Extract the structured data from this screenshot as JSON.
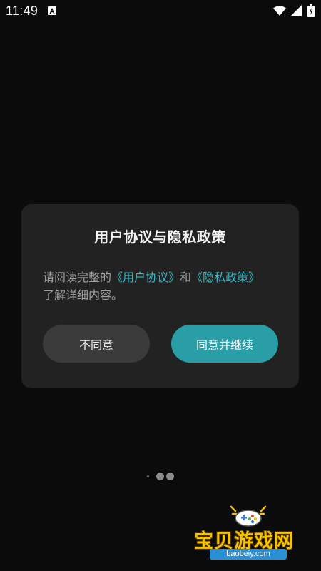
{
  "status_bar": {
    "time": "11:49",
    "app_icon": "a-notification-icon",
    "wifi_icon": "wifi-icon",
    "signal_icon": "signal-icon",
    "battery_icon": "battery-icon"
  },
  "dialog": {
    "title": "用户协议与隐私政策",
    "message_prefix": "请阅读完整的",
    "link_user_agreement": "《用户协议》",
    "message_and": "和",
    "link_privacy_policy": "《隐私政策》",
    "message_suffix": "了解详细内容。",
    "disagree_label": "不同意",
    "agree_label": "同意并继续"
  },
  "colors": {
    "background": "#0b0b0b",
    "dialog_background": "#222222",
    "link": "#39b7c4",
    "agree_button": "#2a9ea7",
    "disagree_button": "#3b3b3b"
  },
  "pager": {
    "pages": 2
  },
  "watermark": {
    "text": "宝贝游戏网",
    "url": "baobeiy.com",
    "logo_icon": "gamepad-icon"
  }
}
